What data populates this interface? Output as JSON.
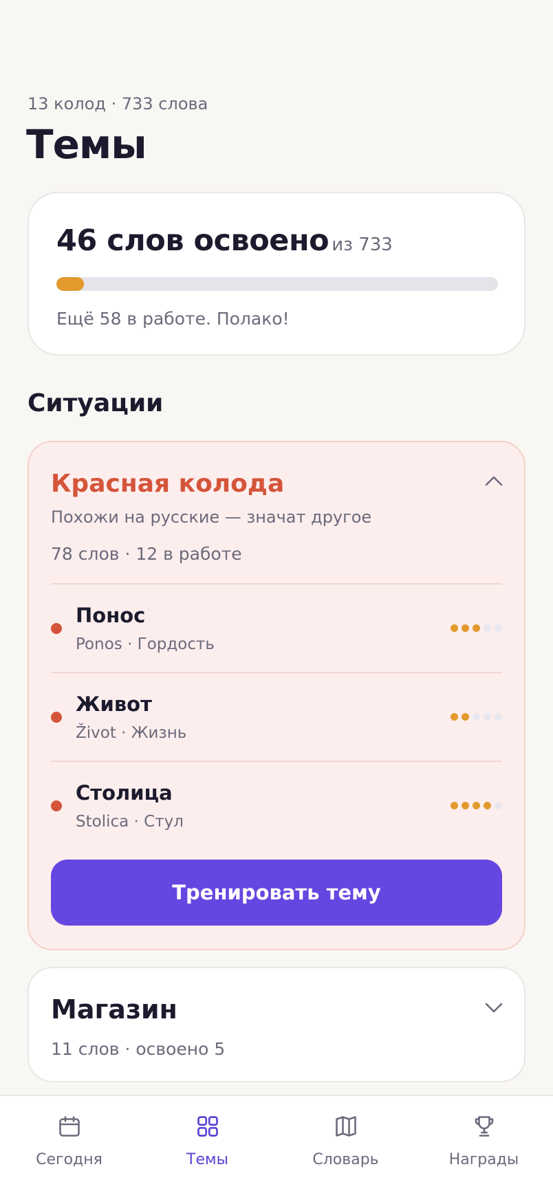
{
  "header": {
    "subtitle": "13 колод · 733 слова",
    "title": "Темы"
  },
  "progress": {
    "learned_label": "46 слов освоено",
    "total_label": "из 733",
    "learned": 46,
    "total": 733,
    "fill_fraction": 0.063,
    "note": "Ещё 58 в работе. Полако!"
  },
  "section": {
    "title": "Ситуации"
  },
  "deck": {
    "title": "Красная колода",
    "description": "Похожи на русские — значат другое",
    "stats": "78 слов · 12 в работе",
    "expanded": true,
    "words": [
      {
        "word": "Понос",
        "translation": "Ponos · Гордость",
        "level": 3,
        "max_level": 5
      },
      {
        "word": "Живот",
        "translation": "Život · Жизнь",
        "level": 2,
        "max_level": 5
      },
      {
        "word": "Столица",
        "translation": "Stolica · Стул",
        "level": 4,
        "max_level": 5
      }
    ],
    "train_button": "Тренировать тему"
  },
  "shop": {
    "title": "Магазин",
    "stats": "11 слов · освоено 5",
    "expanded": false
  },
  "nav": {
    "items": [
      {
        "label": "Сегодня",
        "icon": "calendar-icon",
        "active": false
      },
      {
        "label": "Темы",
        "icon": "grid-icon",
        "active": true
      },
      {
        "label": "Словарь",
        "icon": "book-icon",
        "active": false
      },
      {
        "label": "Награды",
        "icon": "trophy-icon",
        "active": false
      }
    ]
  },
  "colors": {
    "accent": "#6646e0",
    "progress": "#e39a2d",
    "deck_red": "#d4553a",
    "background": "#f9f7f4"
  }
}
